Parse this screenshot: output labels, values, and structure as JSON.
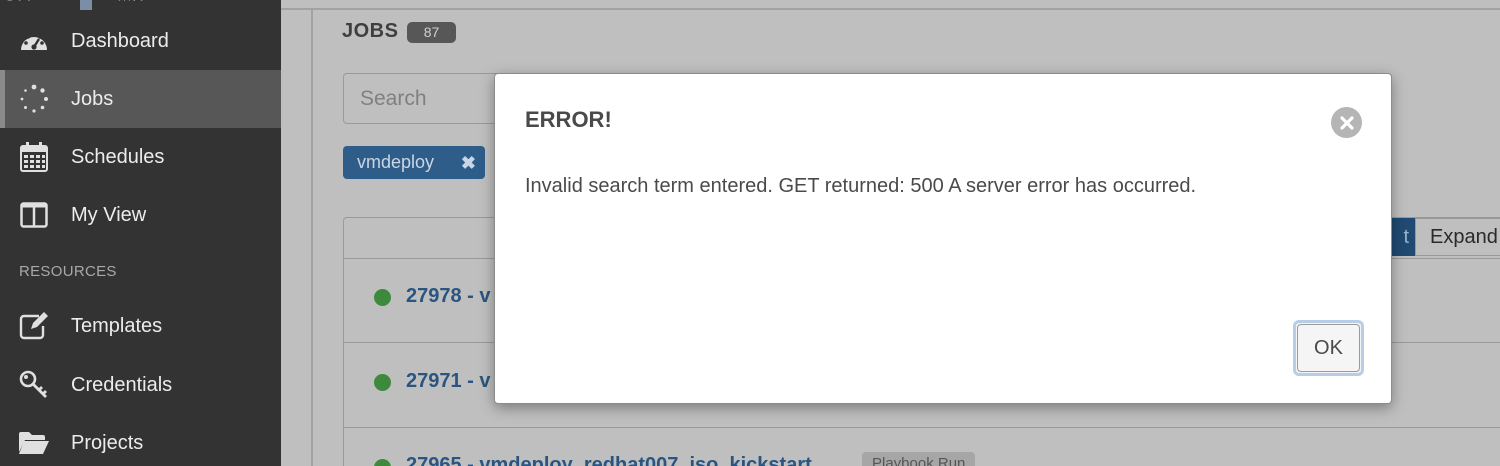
{
  "sidebar": {
    "items": [
      {
        "label": "Dashboard",
        "icon": "dashboard-icon"
      },
      {
        "label": "Jobs",
        "icon": "spinner-icon",
        "active": true
      },
      {
        "label": "Schedules",
        "icon": "calendar-icon"
      },
      {
        "label": "My View",
        "icon": "columns-icon"
      }
    ],
    "section_label": "RESOURCES",
    "resource_items": [
      {
        "label": "Templates",
        "icon": "edit-icon"
      },
      {
        "label": "Credentials",
        "icon": "key-icon"
      },
      {
        "label": "Projects",
        "icon": "folder-open-icon"
      }
    ]
  },
  "main": {
    "title": "JOBS",
    "count": "87",
    "search_placeholder": "Search",
    "tag": "vmdeploy",
    "toggle": {
      "compact_partial": "t",
      "expand_partial": "Expand"
    },
    "jobs": [
      {
        "id_text": "27978 - v"
      },
      {
        "id_text": "27971 - v"
      },
      {
        "id_text": "27965 - vmdeploy_redhat007_iso_kickstart",
        "badge": "Playbook Run"
      }
    ]
  },
  "modal": {
    "title": "ERROR!",
    "message": "Invalid search term entered. GET returned: 500 A server error has occurred.",
    "ok_label": "OK"
  },
  "colors": {
    "sidebar_bg": "#333333",
    "overlay_bg": "#bfbfbf",
    "link_blue": "#2a5580",
    "success_green": "#3d8a3d",
    "modal_bg": "#ffffff"
  }
}
